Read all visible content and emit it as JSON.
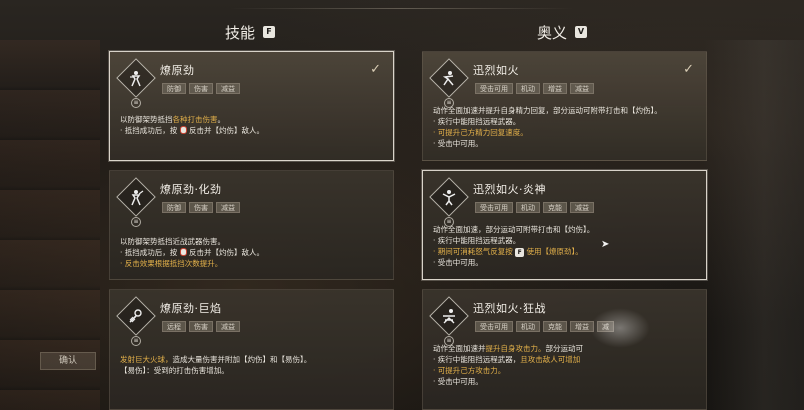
{
  "skills": {
    "title": "技能",
    "key": "F",
    "cards": [
      {
        "name": "燎原劲",
        "tags": [
          "防御",
          "伤害",
          "减益"
        ],
        "selected": true,
        "lines": [
          {
            "pre": "以防御架势抵挡",
            "hl": "各种打击伤害",
            "post": "。",
            "hlcolor": "orange"
          },
          {
            "pre": "· 抵挡成功后，按 ",
            "hl": "",
            "post": " 反击并【灼伤】敌人。",
            "hlcolor": ""
          }
        ]
      },
      {
        "name": "燎原劲·化劲",
        "tags": [
          "防御",
          "伤害",
          "减益"
        ],
        "selected": false,
        "lines": [
          {
            "pre": "以防御架势抵挡近战武器伤害。",
            "hl": "",
            "post": "",
            "hlcolor": ""
          },
          {
            "pre": "· 抵挡成功后，按 ",
            "hl": "",
            "post": " 反击并【灼伤】敌人。",
            "hlcolor": ""
          },
          {
            "pre": "",
            "hl": "· 反击效果根据抵挡次数提升。",
            "post": "",
            "hlcolor": "orange"
          }
        ]
      },
      {
        "name": "燎原劲·巨焰",
        "tags": [
          "远程",
          "伤害",
          "减益"
        ],
        "selected": false,
        "lines": [
          {
            "pre": "",
            "hl": "发射巨大火球，",
            "post": "造成大量伤害并附加【灼伤】和【易伤】。",
            "hlcolor": "orange"
          },
          {
            "pre": "【易伤】：受到的打击伤害增加。",
            "hl": "",
            "post": "",
            "hlcolor": ""
          }
        ]
      }
    ]
  },
  "mysteries": {
    "title": "奥义",
    "key": "V",
    "cards": [
      {
        "name": "迅烈如火",
        "tags": [
          "受击可用",
          "机动",
          "增益",
          "减益"
        ],
        "selected": true,
        "lines": [
          {
            "pre": "动作全面加速并提升自身精力回复，部分运动可附带打击和【灼伤】。",
            "hl": "",
            "post": "",
            "hlcolor": ""
          },
          {
            "pre": "· 疾行中能阻挡远程武器。",
            "hl": "",
            "post": "",
            "hlcolor": ""
          },
          {
            "pre": "",
            "hl": "· 可提升己方精力回复速度。",
            "post": "",
            "hlcolor": "orange"
          },
          {
            "pre": "· 受击中可用。",
            "hl": "",
            "post": "",
            "hlcolor": ""
          }
        ]
      },
      {
        "name": "迅烈如火·炎神",
        "tags": [
          "受击可用",
          "机动",
          "克能",
          "减益"
        ],
        "selected": false,
        "lines": [
          {
            "pre": "动作全面加速，部分运动可附带打击和【灼伤】。",
            "hl": "",
            "post": "",
            "hlcolor": ""
          },
          {
            "pre": "· 疾行中能阻挡远程武器。",
            "hl": "",
            "post": "",
            "hlcolor": ""
          },
          {
            "pre": "",
            "hl": "· 期间可消耗怒气反复按 ",
            "post": "",
            "hlcolor": "orange",
            "key": "F",
            "tail": " 使用【燎原劲】。"
          },
          {
            "pre": "· 受击中可用。",
            "hl": "",
            "post": "",
            "hlcolor": ""
          }
        ]
      },
      {
        "name": "迅烈如火·狂战",
        "tags": [
          "受击可用",
          "机动",
          "克能",
          "增益",
          "减"
        ],
        "selected": false,
        "lines": [
          {
            "pre": "动作全面加速并",
            "hl": "提升自身攻击力。",
            "post": "部分运动可",
            "hlcolor": "orange"
          },
          {
            "pre": "· 疾行中能阻挡远程武器，",
            "hl": "且攻击敌人可增加",
            "post": "",
            "hlcolor": "orange"
          },
          {
            "pre": "",
            "hl": "· 可提升己方攻击力。",
            "post": "",
            "hlcolor": "orange"
          },
          {
            "pre": "· 受击中可用。",
            "hl": "",
            "post": "",
            "hlcolor": ""
          }
        ]
      }
    ]
  },
  "side_button": "确认"
}
